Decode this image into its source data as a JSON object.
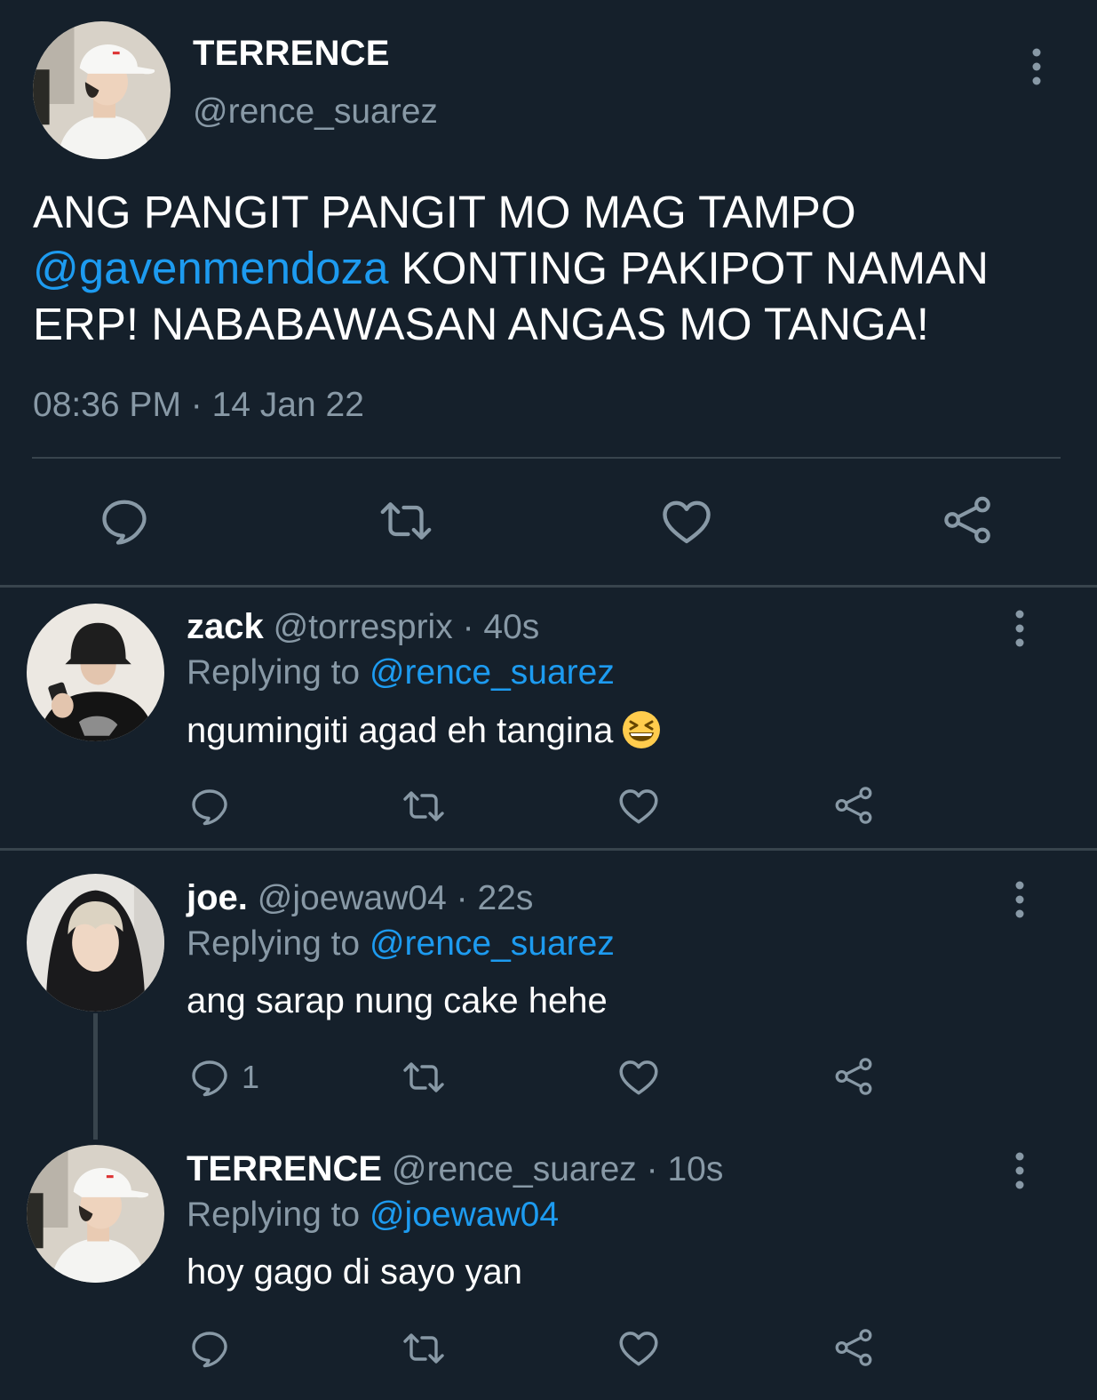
{
  "main_tweet": {
    "author_name": "TERRENCE",
    "author_handle": "@rence_suarez",
    "avatar_icon": "avatar-white-cap",
    "text_part1": "ANG PANGIT PANGIT MO MAG TAMPO ",
    "mention": "@gavenmendoza",
    "text_part2": " KONTING PAKIPOT NAMAN ERP! NABABAWASAN ANGAS MO TANGA!",
    "timestamp": "08:36 PM · 14 Jan 22",
    "actions": [
      "reply-icon",
      "retweet-icon",
      "like-icon",
      "share-icon"
    ]
  },
  "replies": [
    {
      "name": "zack",
      "handle": "@torresprix",
      "time": "· 40s",
      "replying_prefix": "Replying to",
      "replying_handle": "@rence_suarez",
      "text": "ngumingiti agad eh tangina",
      "emoji": "grinning-squinting-face-emoji",
      "reply_count": "",
      "avatar_icon": "avatar-bucket-hat"
    },
    {
      "name": "joe.",
      "handle": "@joewaw04",
      "time": "· 22s",
      "replying_prefix": "Replying to",
      "replying_handle": "@rence_suarez",
      "text": "ang sarap nung cake hehe",
      "reply_count": "1",
      "avatar_icon": "avatar-hoodie"
    },
    {
      "name": "TERRENCE",
      "handle": "@rence_suarez",
      "time": "· 10s",
      "replying_prefix": "Replying to",
      "replying_handle": "@joewaw04",
      "text": "hoy gago di sayo yan",
      "reply_count": "",
      "avatar_icon": "avatar-white-cap"
    }
  ],
  "colors": {
    "background": "#15202b",
    "divider": "#38444d",
    "secondary_text": "#8899a6",
    "link": "#1d9bf0",
    "primary_text": "#ffffff"
  }
}
